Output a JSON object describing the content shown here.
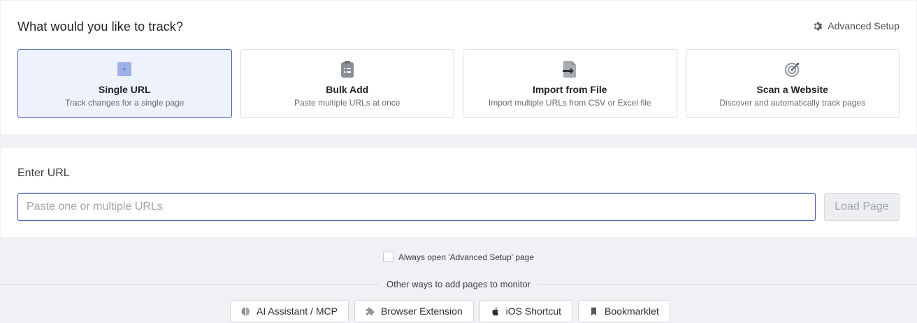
{
  "track": {
    "title": "What would you like to track?",
    "advanced_label": "Advanced Setup",
    "cards": [
      {
        "title": "Single URL",
        "subtitle": "Track changes for a single page",
        "icon": "single-url-icon",
        "active": true
      },
      {
        "title": "Bulk Add",
        "subtitle": "Paste multiple URLs at once",
        "icon": "clipboard-list-icon",
        "active": false
      },
      {
        "title": "Import from File",
        "subtitle": "Import multiple URLs from CSV or Excel file",
        "icon": "file-import-icon",
        "active": false
      },
      {
        "title": "Scan a Website",
        "subtitle": "Discover and automatically track pages",
        "icon": "target-icon",
        "active": false
      }
    ]
  },
  "url_entry": {
    "label": "Enter URL",
    "placeholder": "Paste one or multiple URLs",
    "value": "",
    "load_label": "Load Page"
  },
  "always_open": {
    "label": "Always open 'Advanced Setup' page",
    "checked": false
  },
  "other_ways": {
    "label": "Other ways to add pages to monitor",
    "buttons": [
      {
        "label": "AI Assistant / MCP",
        "icon": "brain-icon"
      },
      {
        "label": "Browser Extension",
        "icon": "puzzle-icon"
      },
      {
        "label": "iOS Shortcut",
        "icon": "apple-icon"
      },
      {
        "label": "Bookmarklet",
        "icon": "bookmark-icon"
      }
    ]
  },
  "colors": {
    "accent": "#3f5fb0",
    "active_card_bg": "#edf2fc",
    "page_bg": "#f0f1f4"
  }
}
